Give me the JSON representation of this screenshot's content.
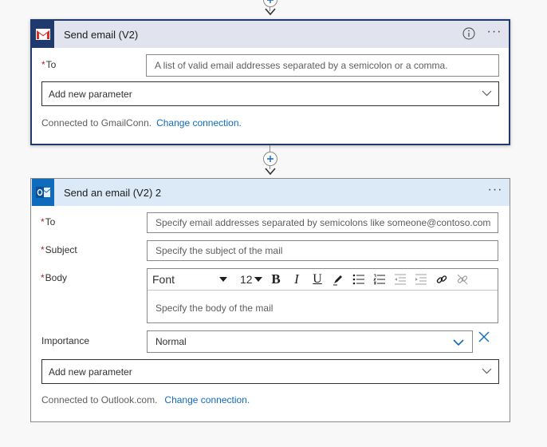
{
  "colors": {
    "card1_border": "#203a6e",
    "card1_header_bg": "#e1e3ee",
    "card2_header_bg": "#dbeaf6",
    "link": "#0f6cbd",
    "required": "#a4262c",
    "gmail_red": "#d93025",
    "outlook_blue": "#0f6cbd"
  },
  "gmail_action": {
    "icon": "gmail-icon",
    "title": "Send email (V2)",
    "to_label": "To",
    "to_placeholder": "A list of valid email addresses separated by a semicolon or a comma.",
    "add_param_label": "Add new parameter",
    "connected_text": "Connected to GmailConn.",
    "change_connection": "Change connection."
  },
  "outlook_action": {
    "icon": "outlook-icon",
    "title": "Send an email (V2) 2",
    "to_label": "To",
    "to_placeholder": "Specify email addresses separated by semicolons like someone@contoso.com",
    "subject_label": "Subject",
    "subject_placeholder": "Specify the subject of the mail",
    "body_label": "Body",
    "font_label": "Font",
    "font_size": "12",
    "body_placeholder": "Specify the body of the mail",
    "importance_label": "Importance",
    "importance_value": "Normal",
    "add_param_label": "Add new parameter",
    "connected_text": "Connected to Outlook.com.",
    "change_connection": "Change connection."
  }
}
